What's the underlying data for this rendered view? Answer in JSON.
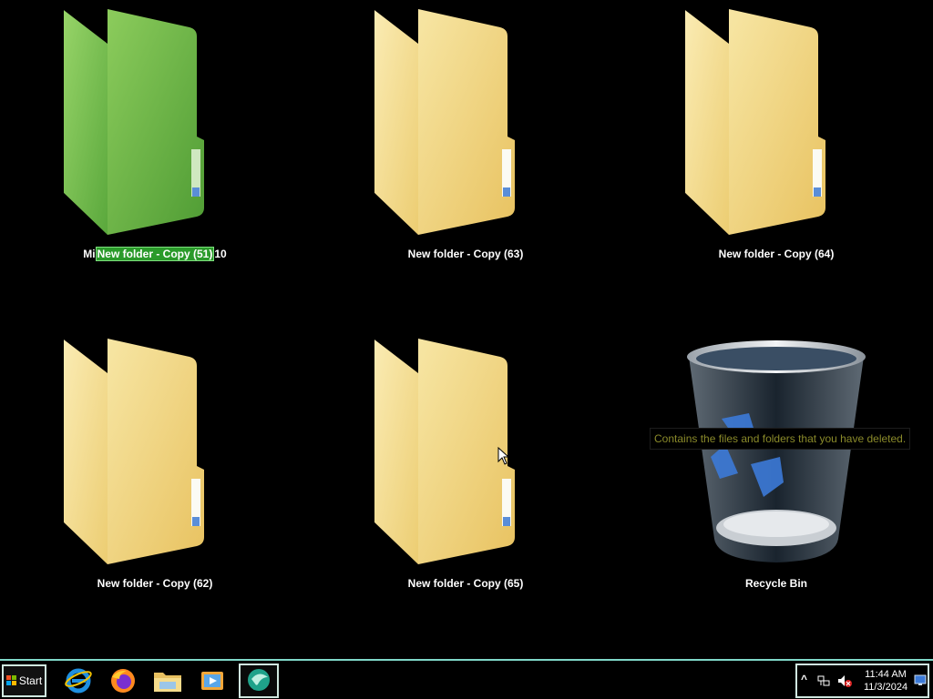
{
  "desktop": {
    "icons": [
      {
        "label": "New folder - Copy (51)",
        "label_prefix": "Mi",
        "label_suffix": "10",
        "editing": true,
        "icon": "folder-green-icon"
      },
      {
        "label": "New folder - Copy (63)",
        "icon": "folder-icon"
      },
      {
        "label": "New folder - Copy (64)",
        "icon": "folder-icon"
      },
      {
        "label": "New folder - Copy (62)",
        "icon": "folder-icon"
      },
      {
        "label": "New folder - Copy (65)",
        "icon": "folder-icon"
      },
      {
        "label": "Recycle Bin",
        "icon": "recycle-bin-icon"
      }
    ],
    "tooltip": "Contains the files and folders that you have deleted."
  },
  "taskbar": {
    "start_label": "Start",
    "pinned": [
      {
        "name": "internet-explorer-icon"
      },
      {
        "name": "firefox-icon"
      },
      {
        "name": "file-explorer-icon"
      },
      {
        "name": "media-player-icon"
      },
      {
        "name": "app-icon",
        "active": true
      }
    ],
    "tray": {
      "show_hidden_symbol": "^",
      "time": "11:44 AM",
      "date": "11/3/2024"
    }
  },
  "colors": {
    "folder_yellow": "#f3d67a",
    "folder_green": "#6fb94a",
    "taskbar_border": "#7fd8c8",
    "edit_highlight": "#2a9a2a"
  }
}
